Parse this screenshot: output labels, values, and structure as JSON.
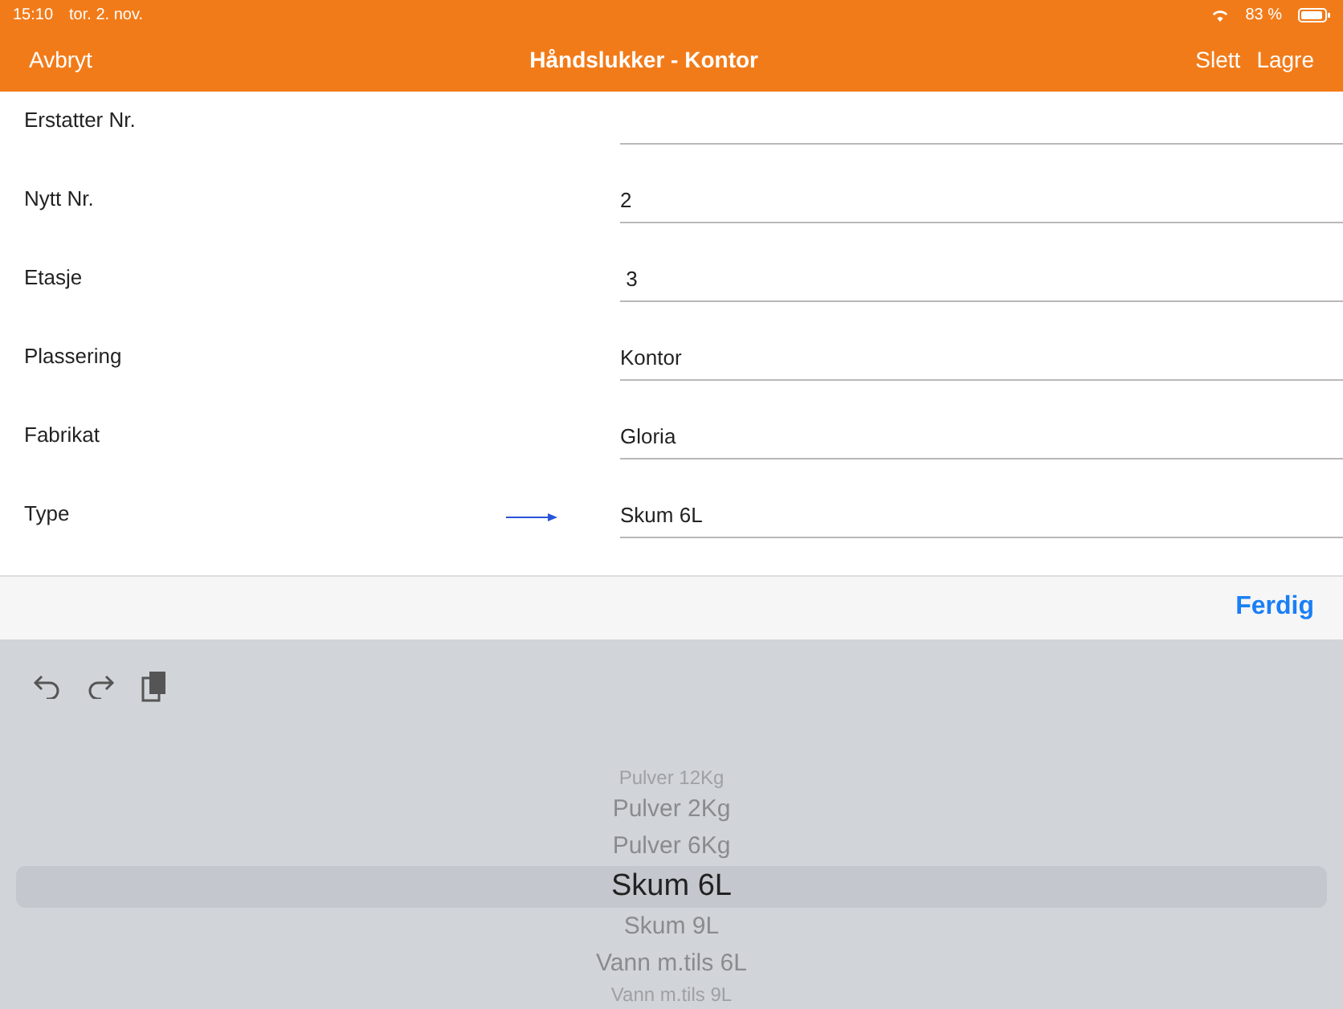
{
  "status_bar": {
    "time": "15:10",
    "date": "tor. 2. nov.",
    "battery": "83 %"
  },
  "nav": {
    "cancel": "Avbryt",
    "title": "Håndslukker - Kontor",
    "actions": [
      "Slett",
      "Lagre"
    ]
  },
  "fields": [
    {
      "label": "Erstatter Nr.",
      "marked": false
    },
    {
      "label": "Nytt Nr.",
      "value": "2",
      "marked": false
    },
    {
      "label": "Etasje",
      "value": " 3",
      "marked": false
    },
    {
      "label": "Plassering",
      "value": "Kontor",
      "marked": false
    },
    {
      "label": "Fabrikat",
      "value": "Gloria",
      "marked": false
    },
    {
      "label": "Type",
      "value": "Skum 6L",
      "marked": true
    }
  ],
  "accessory": {
    "done": "Ferdig"
  },
  "picker": [
    {
      "label": "Pulver 12Kg",
      "selected": false
    },
    {
      "label": "Pulver 2Kg",
      "selected": false
    },
    {
      "label": "Pulver 6Kg",
      "selected": false
    },
    {
      "label": "Skum 6L",
      "selected": true
    },
    {
      "label": "Skum 9L",
      "selected": false
    },
    {
      "label": "Vann m.tils 6L",
      "selected": false
    },
    {
      "label": "Vann m.tils 9L",
      "selected": false
    }
  ]
}
